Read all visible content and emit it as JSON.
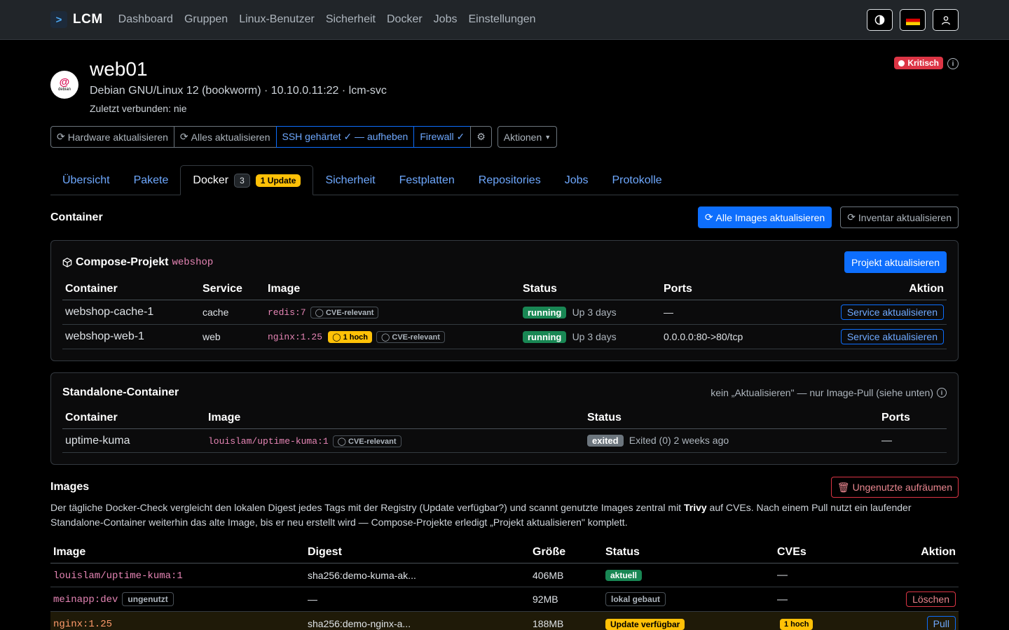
{
  "nav": {
    "brand": "LCM",
    "links": [
      "Dashboard",
      "Gruppen",
      "Linux-Benutzer",
      "Sicherheit",
      "Docker",
      "Jobs",
      "Einstellungen"
    ]
  },
  "host": {
    "name": "web01",
    "os_logo": "debian",
    "meta": "Debian GNU/Linux 12 (bookworm) · 10.10.0.11:22 · lcm-svc",
    "last_connected": "Zuletzt verbunden: nie",
    "status_badge": "Kritisch"
  },
  "actions": {
    "hardware": "Hardware aktualisieren",
    "all": "Alles aktualisieren",
    "ssh": "SSH gehärtet ✓ — aufheben",
    "firewall": "Firewall ✓",
    "menu": "Aktionen"
  },
  "tabs": {
    "overview": "Übersicht",
    "packages": "Pakete",
    "docker": "Docker",
    "docker_count": "3",
    "docker_update": "1 Update",
    "security": "Sicherheit",
    "disks": "Festplatten",
    "repos": "Repositories",
    "jobs": "Jobs",
    "logs": "Protokolle"
  },
  "containers": {
    "title": "Container",
    "update_all_btn": "Alle Images aktualisieren",
    "inventory_btn": "Inventar aktualisieren"
  },
  "compose": {
    "label": "Compose-Projekt",
    "project": "webshop",
    "update_btn": "Projekt aktualisieren",
    "headers": [
      "Container",
      "Service",
      "Image",
      "Status",
      "Ports",
      "Aktion"
    ],
    "rows": [
      {
        "container": "webshop-cache-1",
        "service": "cache",
        "image": "redis:7",
        "warn": "",
        "cve": "CVE-relevant",
        "state": "running",
        "status": "Up 3 days",
        "ports": "—",
        "action": "Service aktualisieren"
      },
      {
        "container": "webshop-web-1",
        "service": "web",
        "image": "nginx:1.25",
        "warn": "1 hoch",
        "cve": "CVE-relevant",
        "state": "running",
        "status": "Up 3 days",
        "ports": "0.0.0.0:80->80/tcp",
        "action": "Service aktualisieren"
      }
    ]
  },
  "standalone": {
    "title": "Standalone-Container",
    "hint": "kein „Aktualisieren\" — nur Image-Pull (siehe unten)",
    "headers": [
      "Container",
      "Image",
      "Status",
      "Ports"
    ],
    "rows": [
      {
        "container": "uptime-kuma",
        "image": "louislam/uptime-kuma:1",
        "cve": "CVE-relevant",
        "state": "exited",
        "status": "Exited (0) 2 weeks ago",
        "ports": "—"
      }
    ]
  },
  "images": {
    "title": "Images",
    "cleanup_btn": "Ungenutzte aufräumen",
    "desc_1": "Der tägliche Docker-Check vergleicht den lokalen Digest jedes Tags mit der Registry (Update verfügbar?) und scannt genutzte Images zentral mit ",
    "desc_bold": "Trivy",
    "desc_2": " auf CVEs. Nach einem Pull nutzt ein laufender Standalone-Container weiterhin das alte Image, bis er neu erstellt wird — Compose-Projekte erledigt „Projekt aktualisieren\" komplett.",
    "headers": [
      "Image",
      "Digest",
      "Größe",
      "Status",
      "CVEs",
      "Aktion"
    ],
    "rows": [
      {
        "image": "louislam/uptime-kuma:1",
        "tag": "",
        "digest": "sha256:demo-kuma-ak...",
        "size": "406MB",
        "status": "aktuell",
        "cves": "—",
        "action": ""
      },
      {
        "image": "meinapp:dev",
        "tag": "ungenutzt",
        "digest": "—",
        "size": "92MB",
        "status": "lokal gebaut",
        "cves": "—",
        "action": "Löschen"
      },
      {
        "image": "nginx:1.25",
        "tag": "",
        "digest": "sha256:demo-nginx-a...",
        "size": "188MB",
        "status": "Update verfügbar",
        "cves": "1 hoch",
        "action": "Pull"
      }
    ]
  }
}
